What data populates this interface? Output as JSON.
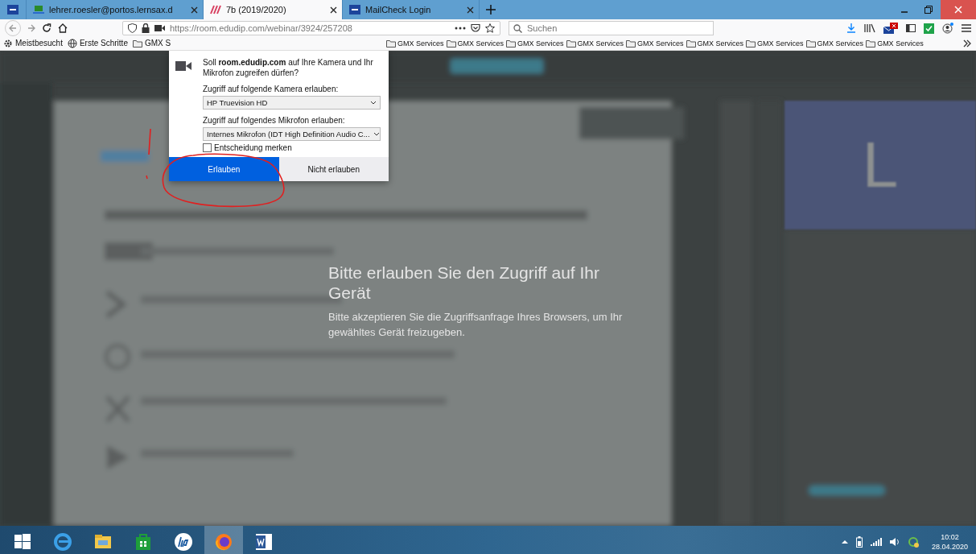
{
  "tabs": [
    {
      "kind": "pinned",
      "selected": false
    },
    {
      "kind": "tab",
      "title": "lehrer.roesler@portos.lernsax.d",
      "selected": false
    },
    {
      "kind": "tab",
      "title": "7b (2019/2020)",
      "selected": true
    },
    {
      "kind": "tab",
      "title": "MailCheck Login",
      "selected": false
    }
  ],
  "address_bar": {
    "url": "https://room.edudip.com/webinar/3924/257208"
  },
  "search": {
    "placeholder": "Suchen"
  },
  "bookmarks": [
    {
      "kind": "gear",
      "label": "Meistbesucht"
    },
    {
      "kind": "globe",
      "label": "Erste Schritte"
    },
    {
      "kind": "folder",
      "label": "GMX S"
    }
  ],
  "bookmarks_right": [
    {
      "label": "GMX Services"
    },
    {
      "label": "GMX Services"
    },
    {
      "label": "GMX Services"
    },
    {
      "label": "GMX Services"
    },
    {
      "label": "GMX Services"
    },
    {
      "label": "GMX Services"
    },
    {
      "label": "GMX Services"
    },
    {
      "label": "GMX Services"
    },
    {
      "label": "GMX Services"
    }
  ],
  "permission_popup": {
    "question": "Soll **room.edudip.com** auf Ihre Kamera und Ihr Mikrofon zugreifen dürfen?",
    "camera_label": "Zugriff auf folgende Kamera erlauben:",
    "camera_value": "HP Truevision HD",
    "mic_label": "Zugriff auf folgendes Mikrofon erlauben:",
    "mic_value": "Internes Mikrofon (IDT High Definition Audio C...",
    "remember": {
      "label": "Entscheidung merken",
      "checked": false
    },
    "buttons": [
      {
        "label": "Erlauben",
        "kind": "primary"
      },
      {
        "label": "Nicht erlauben",
        "kind": "secondary"
      }
    ]
  },
  "video_tile": {
    "letter": "L"
  },
  "overlay": {
    "title": "Bitte erlauben Sie den Zugriff auf Ihr Gerät",
    "message": "Bitte akzeptieren Sie die Zugriffsanfrage Ihres Browsers, um Ihr gewähltes Gerät freizugeben."
  },
  "taskbar": {
    "apps": [
      {
        "kind": "ie",
        "selected": false
      },
      {
        "kind": "explorer",
        "selected": false
      },
      {
        "kind": "store",
        "selected": false
      },
      {
        "kind": "hp",
        "selected": false
      },
      {
        "kind": "firefox",
        "selected": true
      },
      {
        "kind": "word",
        "selected": false
      }
    ],
    "time": "10:02",
    "date": "28.04.2020"
  }
}
